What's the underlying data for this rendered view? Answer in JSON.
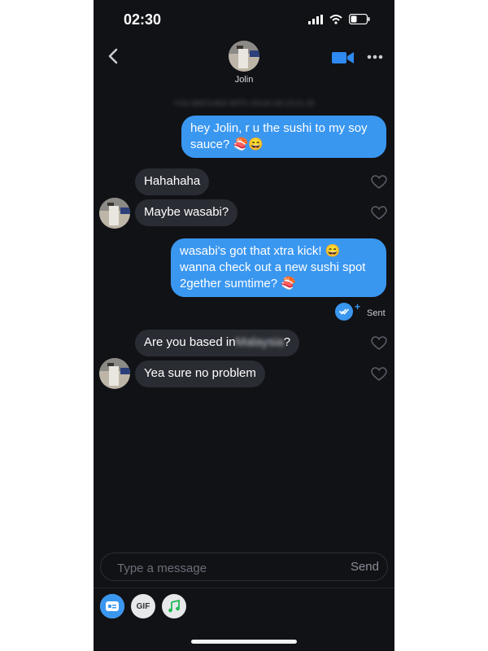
{
  "status_bar": {
    "time": "02:30"
  },
  "header": {
    "contact_name": "Jolin"
  },
  "match_banner": "YOU MATCHED WITH JOLIN ON 23.01.25",
  "messages": [
    {
      "from": "me",
      "lines": [
        "hey Jolin, r u the sushi to my soy",
        "sauce? 🍣😄"
      ]
    },
    {
      "from": "them",
      "text": "Hahahaha"
    },
    {
      "from": "them",
      "text": "Maybe wasabi?"
    },
    {
      "from": "me",
      "lines": [
        "wasabi's got that xtra kick! 😄",
        "wanna check out a new sushi spot",
        "2gether sumtime? 🍣"
      ]
    },
    {
      "from": "them",
      "text_before": "Are you based in",
      "text_hidden": "Malaysia",
      "text_after": "?"
    },
    {
      "from": "them",
      "text": "Yea sure no problem"
    }
  ],
  "receipt": {
    "status": "Sent"
  },
  "composer": {
    "placeholder": "Type a message",
    "send_label": "Send"
  },
  "toolbar": {
    "gif_label": "GIF"
  },
  "colors": {
    "background": "#111216",
    "outgoing_bubble": "#3a97f0",
    "incoming_bubble": "#2a2c33",
    "accent": "#3a97f0"
  },
  "icons": [
    "back-chevron-icon",
    "video-call-icon",
    "more-options-icon",
    "heart-icon",
    "read-receipt-icon",
    "sticker-icon",
    "music-icon"
  ]
}
